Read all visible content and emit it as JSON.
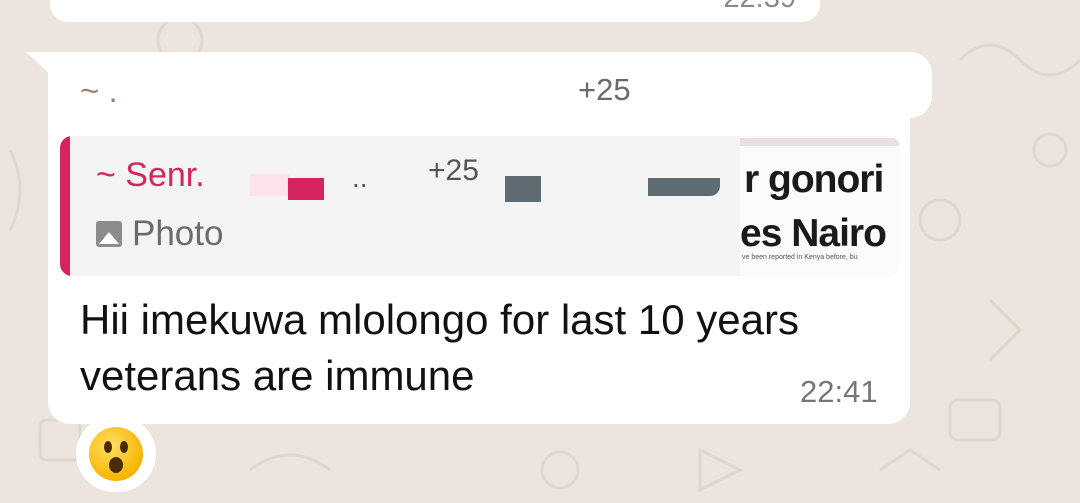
{
  "previous_message": {
    "time": "22:39"
  },
  "message": {
    "sender": "~ .",
    "sender_phone": "+25",
    "quoted": {
      "sender": "~ Senr.",
      "sender_suffix": "..",
      "phone": "+25",
      "type_label": "Photo",
      "thumbnail_text": [
        "r gonori",
        "es Nairo",
        "ve been reported in Kenya before, bu"
      ]
    },
    "text": "Hii imekuwa mlolongo  for last 10 years  veterans  are immune",
    "time": "22:41"
  },
  "reaction": {
    "emoji": "😮",
    "icon": "surprised-face-icon"
  },
  "colors": {
    "background": "#ece5dd",
    "bubble": "#ffffff",
    "quote_accent": "#d6245f",
    "sender": "#a0826d",
    "timestamp": "#767676"
  }
}
